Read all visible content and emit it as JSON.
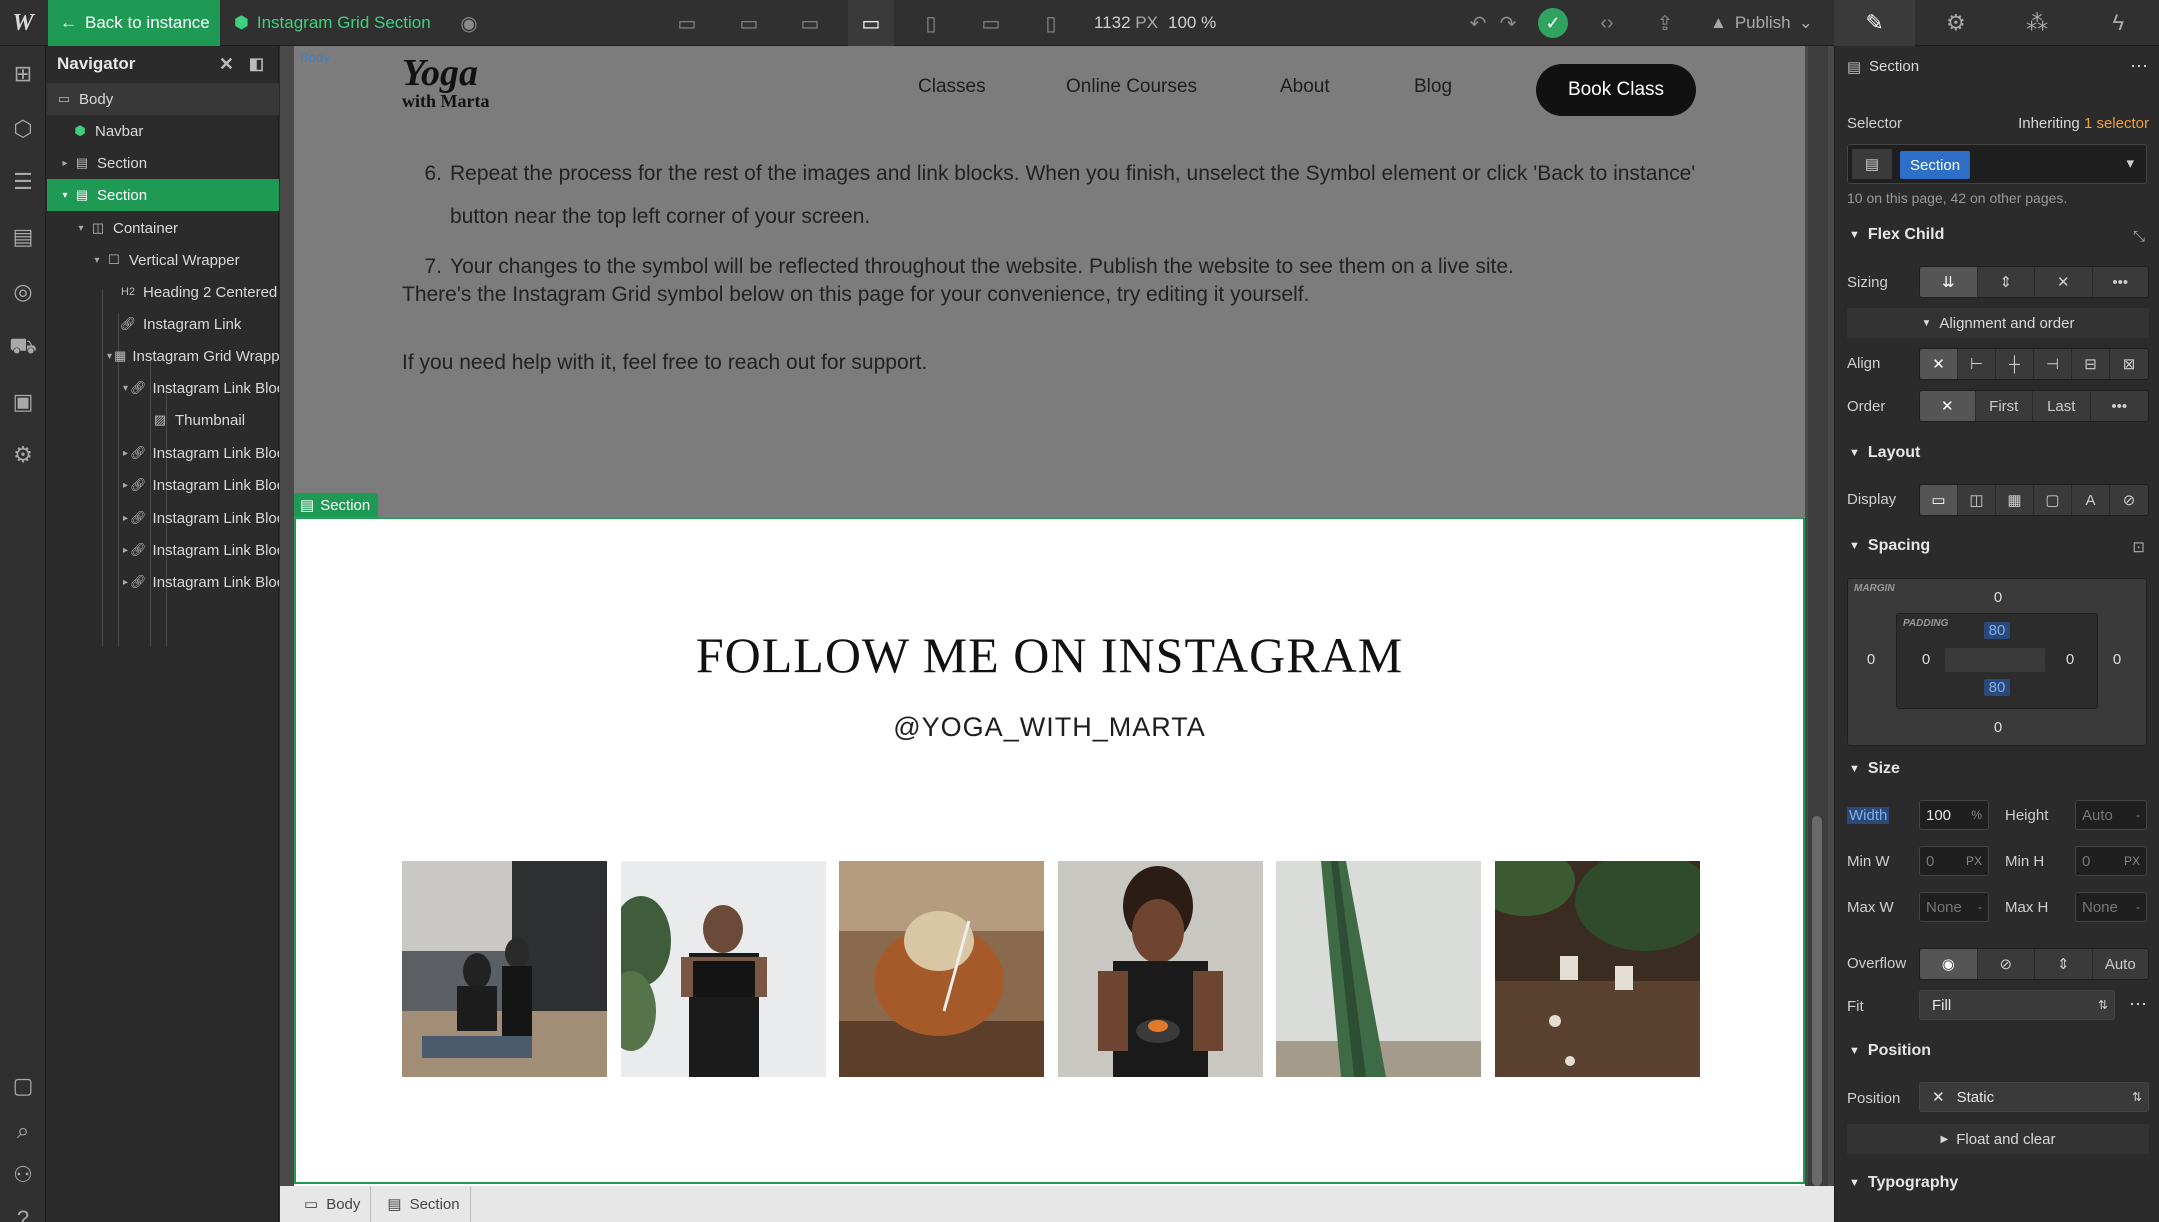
{
  "topbar": {
    "back_label": "Back to instance",
    "symbol_title": "Instagram Grid Section",
    "width_value": "1132",
    "width_unit": "PX",
    "zoom": "100 %",
    "publish_label": "Publish"
  },
  "navigator": {
    "title": "Navigator",
    "items": [
      {
        "label": "Body"
      },
      {
        "label": "Navbar"
      },
      {
        "label": "Section"
      },
      {
        "label": "Section"
      },
      {
        "label": "Container"
      },
      {
        "label": "Vertical Wrapper"
      },
      {
        "label": "Heading 2 Centered"
      },
      {
        "label": "Instagram Link"
      },
      {
        "label": "Instagram Grid Wrapper"
      },
      {
        "label": "Instagram Link Block"
      },
      {
        "label": "Thumbnail"
      },
      {
        "label": "Instagram Link Block"
      },
      {
        "label": "Instagram Link Block"
      },
      {
        "label": "Instagram Link Block"
      },
      {
        "label": "Instagram Link Block"
      },
      {
        "label": "Instagram Link Block"
      }
    ]
  },
  "site": {
    "logo_line1": "Yoga",
    "logo_line2": "with Marta",
    "body_tag": "Body",
    "nav_links": [
      "Classes",
      "Online Courses",
      "About",
      "Blog"
    ],
    "cta": "Book Class",
    "steps": [
      {
        "num": "6.",
        "text": "Repeat the process for the rest of the images and link blocks. When you finish, unselect the Symbol element or click 'Back to instance' button near the top left corner of your screen."
      },
      {
        "num": "7.",
        "text": "Your changes to the symbol will be reflected throughout the website. Publish the website to see them on a live site."
      }
    ],
    "para1": "There's the Instagram Grid symbol below on this page for your convenience, try editing it yourself.",
    "para2": "If you need help with it, feel free to reach out for support.",
    "section_tag": "Section",
    "insta_heading": "FOLLOW ME ON INSTAGRAM",
    "insta_handle": "@YOGA_WITH_MARTA"
  },
  "breadcrumbs": [
    "Body",
    "Section"
  ],
  "style_panel": {
    "element_title": "Section",
    "selector_label": "Selector",
    "inheriting_prefix": "Inheriting",
    "inheriting_link": "1 selector",
    "selector_chip": "Section",
    "usage_note": "10 on this page, 42 on other pages.",
    "flex_child": {
      "title": "Flex Child",
      "sizing_label": "Sizing",
      "alignment_toggle": "Alignment and order",
      "align_label": "Align",
      "order_label": "Order",
      "order_first": "First",
      "order_last": "Last"
    },
    "layout": {
      "title": "Layout",
      "display_label": "Display"
    },
    "spacing": {
      "title": "Spacing",
      "margin_caption": "MARGIN",
      "padding_caption": "PADDING",
      "margin_top": "0",
      "margin_right": "0",
      "margin_bottom": "0",
      "margin_left": "0",
      "padding_top": "80",
      "padding_right": "0",
      "padding_bottom": "80",
      "padding_left": "0"
    },
    "size": {
      "title": "Size",
      "width_label": "Width",
      "width_value": "100",
      "width_unit": "%",
      "height_label": "Height",
      "height_value": "Auto",
      "height_unit": "-",
      "minw_label": "Min W",
      "minw_value": "0",
      "minw_unit": "PX",
      "minh_label": "Min H",
      "minh_value": "0",
      "minh_unit": "PX",
      "maxw_label": "Max W",
      "maxw_value": "None",
      "maxw_unit": "-",
      "maxh_label": "Max H",
      "maxh_value": "None",
      "maxh_unit": "-",
      "overflow_label": "Overflow",
      "overflow_auto": "Auto",
      "fit_label": "Fit",
      "fit_value": "Fill"
    },
    "position": {
      "title": "Position",
      "position_label": "Position",
      "position_value": "Static",
      "float_toggle": "Float and clear"
    },
    "typography": {
      "title": "Typography"
    }
  },
  "colors": {
    "accent_green": "#1f9a55",
    "selector_blue": "#2d6fc6",
    "panel_bg": "#2b2b2b"
  }
}
